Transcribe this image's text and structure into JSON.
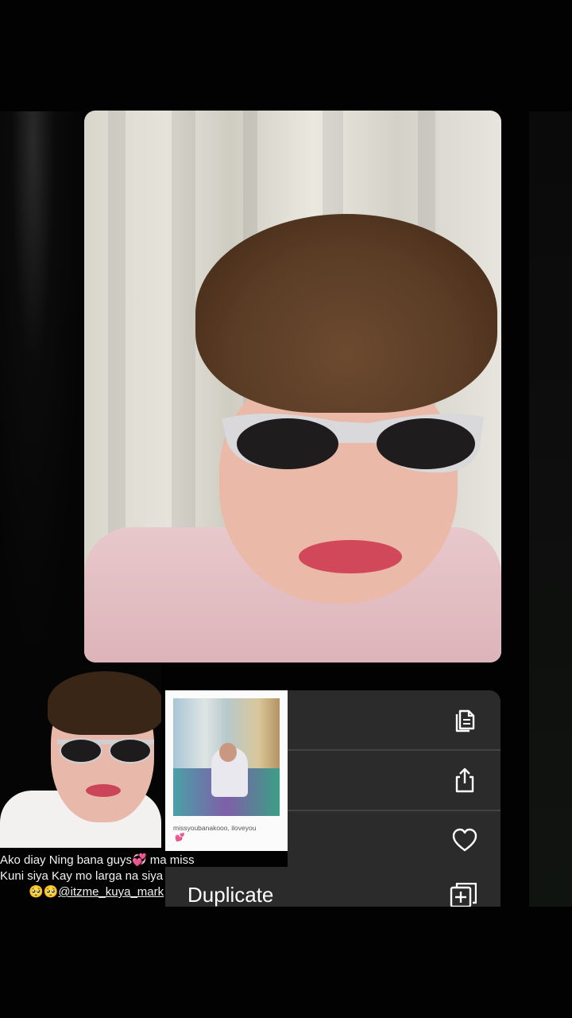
{
  "main_photo": {
    "alt": ""
  },
  "post_thumbnail": {},
  "caption": {
    "line1": "Ako diay Ning bana guys💞 ma miss",
    "line2": "Kuni siya Kay mo larga na siya unya",
    "line3_emoji": "🥺🥺",
    "handle": "@itzme_kuya_mark"
  },
  "polaroid": {
    "caption": "missyoubanakooo, iloveyou",
    "heart": "💕"
  },
  "menu": {
    "items": [
      {
        "icon": "copy-icon"
      },
      {
        "icon": "share-icon"
      },
      {
        "icon": "heart-icon"
      }
    ],
    "duplicate_label": "Duplicate",
    "duplicate_icon": "duplicate-icon"
  },
  "colors": {
    "background": "#020202",
    "menu_bg": "#2b2b2b",
    "divider": "#434343",
    "icon": "#ffffff"
  }
}
